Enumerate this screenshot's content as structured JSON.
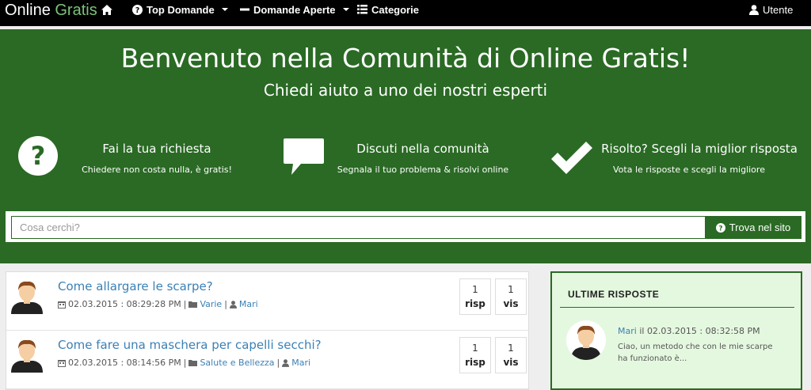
{
  "navbar": {
    "brand_part1": "Online",
    "brand_part2": "Gratis",
    "top_domande": "Top Domande",
    "domande_aperte": "Domande Aperte",
    "categorie": "Categorie",
    "utente": "Utente"
  },
  "hero": {
    "title": "Benvenuto nella Comunità di Online Gratis!",
    "subtitle": "Chiedi aiuto a uno dei nostri esperti",
    "features": [
      {
        "icon": "question-circle-icon",
        "title": "Fai la tua richiesta",
        "desc": "Chiedere non costa nulla, è gratis!"
      },
      {
        "icon": "speech-bubble-icon",
        "title": "Discuti nella comunità",
        "desc": "Segnala il tuo problema & risolvi online"
      },
      {
        "icon": "checkmark-icon",
        "title": "Risolto? Scegli la miglior risposta",
        "desc": "Vota le risposte e scegli la migliore"
      }
    ]
  },
  "search": {
    "placeholder": "Cosa cerchi?",
    "button_label": "Trova nel sito"
  },
  "questions": [
    {
      "title": "Come allargare le scarpe?",
      "date": "02.03.2015 : 08:29:28 PM",
      "category": "Varie",
      "user": "Mari",
      "risp": "1",
      "risp_label": "risp",
      "vis": "1",
      "vis_label": "vis"
    },
    {
      "title": "Come fare una maschera per capelli secchi?",
      "date": "02.03.2015 : 08:14:56 PM",
      "category": "Salute e Bellezza",
      "user": "Mari",
      "risp": "1",
      "risp_label": "risp",
      "vis": "1",
      "vis_label": "vis"
    }
  ],
  "sidebar": {
    "title": "ULTIME RISPOSTE",
    "latest": {
      "user": "Mari",
      "il": "il",
      "date": "02.03.2015 : 08:32:58 PM",
      "text": "Ciao, un metodo che con le mie scarpe ha funzionato è..."
    }
  },
  "colors": {
    "brand_green": "#2a6a24",
    "link_blue": "#3b80b5",
    "sidebar_bg": "#e4f8df"
  }
}
